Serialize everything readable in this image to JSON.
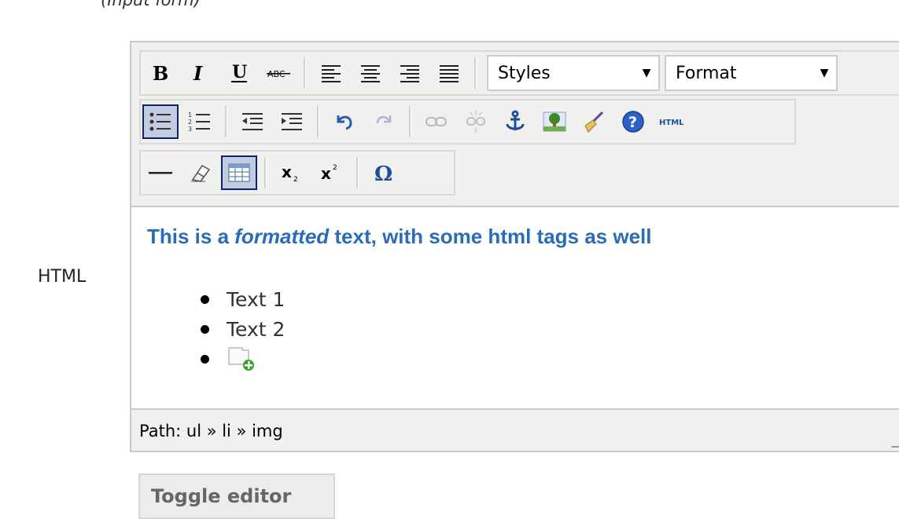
{
  "caption": "(Input form)",
  "field_label": "HTML",
  "toolbar": {
    "styles_select": "Styles",
    "format_select": "Format"
  },
  "content": {
    "heading_pre": "This is a ",
    "heading_em": "formatted",
    "heading_post": " text, with some html tags as well",
    "list_items": [
      "Text 1",
      "Text 2"
    ]
  },
  "statusbar": {
    "path": "Path: ul » li » img"
  },
  "toggle_button": "Toggle editor"
}
